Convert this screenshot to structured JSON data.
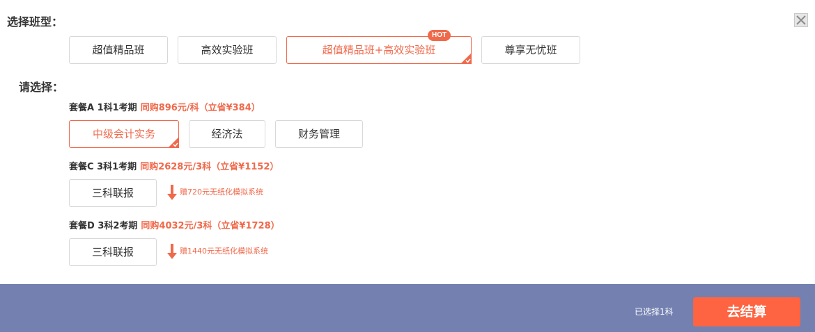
{
  "class_type": {
    "label": "选择班型：",
    "options": [
      "超值精品班",
      "高效实验班",
      "超值精品班+高效实验班",
      "尊享无忧班"
    ],
    "selected_index": 2,
    "hot_badge": "HOT"
  },
  "select": {
    "label": "请选择："
  },
  "packages": [
    {
      "name": "套餐A 1科1考期",
      "price": "同购896元/科（立省¥384）",
      "subjects": [
        "中级会计实务",
        "经济法",
        "财务管理"
      ],
      "selected_index": 0
    },
    {
      "name": "套餐C 3科1考期",
      "price": "同购2628元/3科（立省¥1152）",
      "combo_label": "三科联报",
      "gift": "赠720元无纸化模拟系统"
    },
    {
      "name": "套餐D 3科2考期",
      "price": "同购4032元/3科（立省¥1728）",
      "combo_label": "三科联报",
      "gift": "赠1440元无纸化模拟系统"
    }
  ],
  "footer": {
    "selected_text": "已选择1科",
    "checkout_label": "去结算"
  },
  "colors": {
    "accent": "#f0694b",
    "footer_bg": "#7380b0",
    "checkout_bg": "#fe6441"
  }
}
